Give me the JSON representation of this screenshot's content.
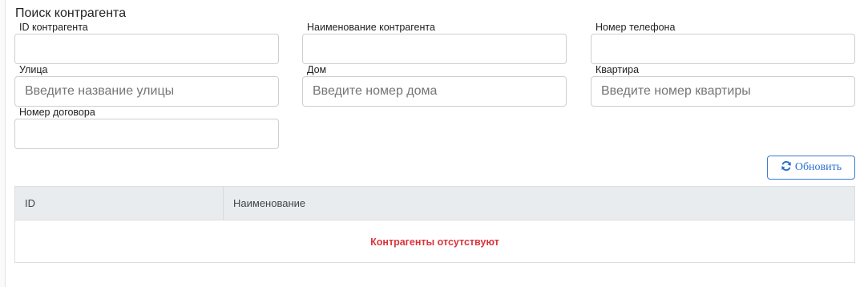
{
  "title": "Поиск контрагента",
  "fields": [
    {
      "label": "ID контрагента",
      "value": "",
      "placeholder": ""
    },
    {
      "label": "Наименование контрагента",
      "value": "",
      "placeholder": ""
    },
    {
      "label": "Номер телефона",
      "value": "",
      "placeholder": ""
    },
    {
      "label": "Улица",
      "value": "",
      "placeholder": "Введите название улицы"
    },
    {
      "label": "Дом",
      "value": "",
      "placeholder": "Введите номер дома"
    },
    {
      "label": "Квартира",
      "value": "",
      "placeholder": "Введите номер квартиры"
    },
    {
      "label": "Номер договора",
      "value": "",
      "placeholder": ""
    }
  ],
  "refresh_button": {
    "label": "Обновить",
    "icon": "refresh-icon",
    "color": "#2a6fcc"
  },
  "table": {
    "columns": [
      "ID",
      "Наименование"
    ],
    "empty_message": "Контрагенты отсутствуют",
    "empty_color": "#d9343a"
  }
}
